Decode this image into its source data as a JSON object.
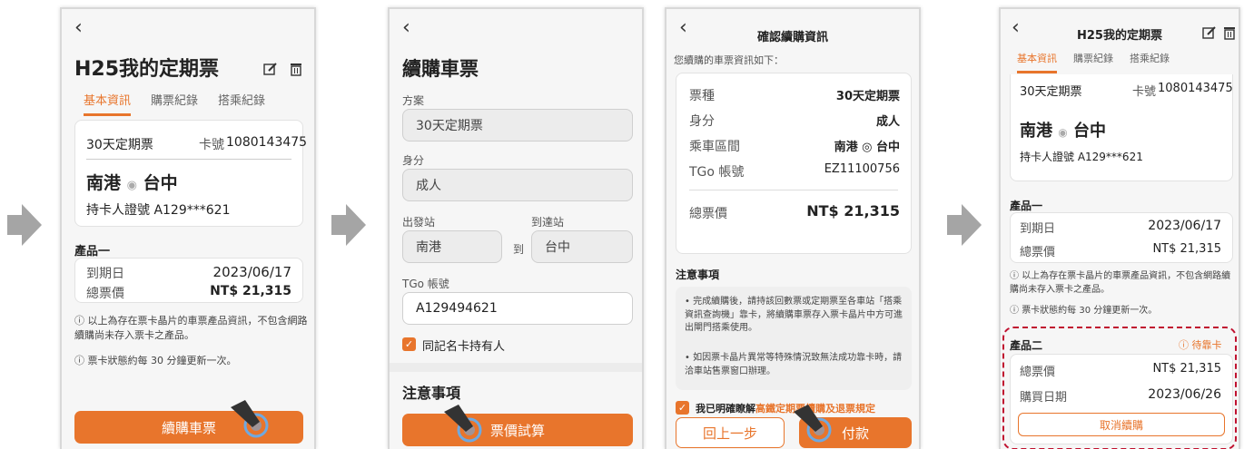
{
  "colors": {
    "accent": "#e8752c",
    "arrow": "#a5a5a5",
    "dashed": "#c0112f"
  },
  "screen1": {
    "title": "H25我的定期票",
    "tabs": [
      "基本資訊",
      "購票紀錄",
      "搭乘紀錄"
    ],
    "ticket_type": "30天定期票",
    "card_no_label": "卡號",
    "card_no": "1080143475",
    "from": "南港",
    "to": "台中",
    "holder": "持卡人證號 A129***621",
    "product_title": "產品一",
    "expire_label": "到期日",
    "expire_value": "2023/06/17",
    "price_label": "總票價",
    "price_value": "NT$ 21,315",
    "note1": "以上為存在票卡晶片的車票產品資訊，不包含網路續購尚未存入票卡之產品。",
    "note2": "票卡狀態約每 30 分鐘更新一次。",
    "button": "續購車票"
  },
  "screen2": {
    "title": "續購車票",
    "plan_label": "方案",
    "plan_value": "30天定期票",
    "identity_label": "身分",
    "identity_value": "成人",
    "from_label": "出發站",
    "to_label": "到達站",
    "from_value": "南港",
    "to_word": "到",
    "to_value": "台中",
    "tgo_label": "TGo 帳號",
    "tgo_value": "A129494621",
    "checkbox_label": "同記名卡持有人",
    "notice_title": "注意事項",
    "button": "票價試算"
  },
  "screen3": {
    "title": "確認續購資訊",
    "intro": "您續購的車票資訊如下：",
    "rows": [
      {
        "label": "票種",
        "value": "30天定期票"
      },
      {
        "label": "身分",
        "value": "成人"
      },
      {
        "label": "乘車區間",
        "value": "南港 ◎ 台中"
      },
      {
        "label": "TGo 帳號",
        "value": "EZ11100756"
      }
    ],
    "total_label": "總票價",
    "total_value": "NT$ 21,315",
    "notice_title": "注意事項",
    "notice1": "完成續購後，請持該回數票或定期票至各車站「搭乘資訊查詢機」靠卡，將續購車票存入票卡晶片中方可進出閘門搭乘使用。",
    "notice2": "如因票卡晶片異常等特殊情況致無法成功靠卡時，請洽車站售票窗口辦理。",
    "agree_prefix": "我已明確瞭解",
    "agree_link": "高鐵定期票續購及退票規定",
    "back_button": "回上一步",
    "pay_button": "付款"
  },
  "screen4": {
    "title": "H25我的定期票",
    "tabs": [
      "基本資訊",
      "購票紀錄",
      "搭乘紀錄"
    ],
    "ticket_type": "30天定期票",
    "card_no_label": "卡號",
    "card_no": "1080143475",
    "from": "南港",
    "to": "台中",
    "holder": "持卡人證號 A129***621",
    "product1_title": "產品一",
    "expire_label": "到期日",
    "expire_value": "2023/06/17",
    "price_label": "總票價",
    "price_value": "NT$ 21,315",
    "note1": "以上為存在票卡晶片的車票產品資訊，不包含網路續購尚未存入票卡之產品。",
    "note2": "票卡狀態約每 30 分鐘更新一次。",
    "product2_title": "產品二",
    "pending": "待靠卡",
    "p2_price_label": "總票價",
    "p2_price_value": "NT$ 21,315",
    "p2_date_label": "購買日期",
    "p2_date_value": "2023/06/26",
    "cancel_button": "取消續購"
  }
}
